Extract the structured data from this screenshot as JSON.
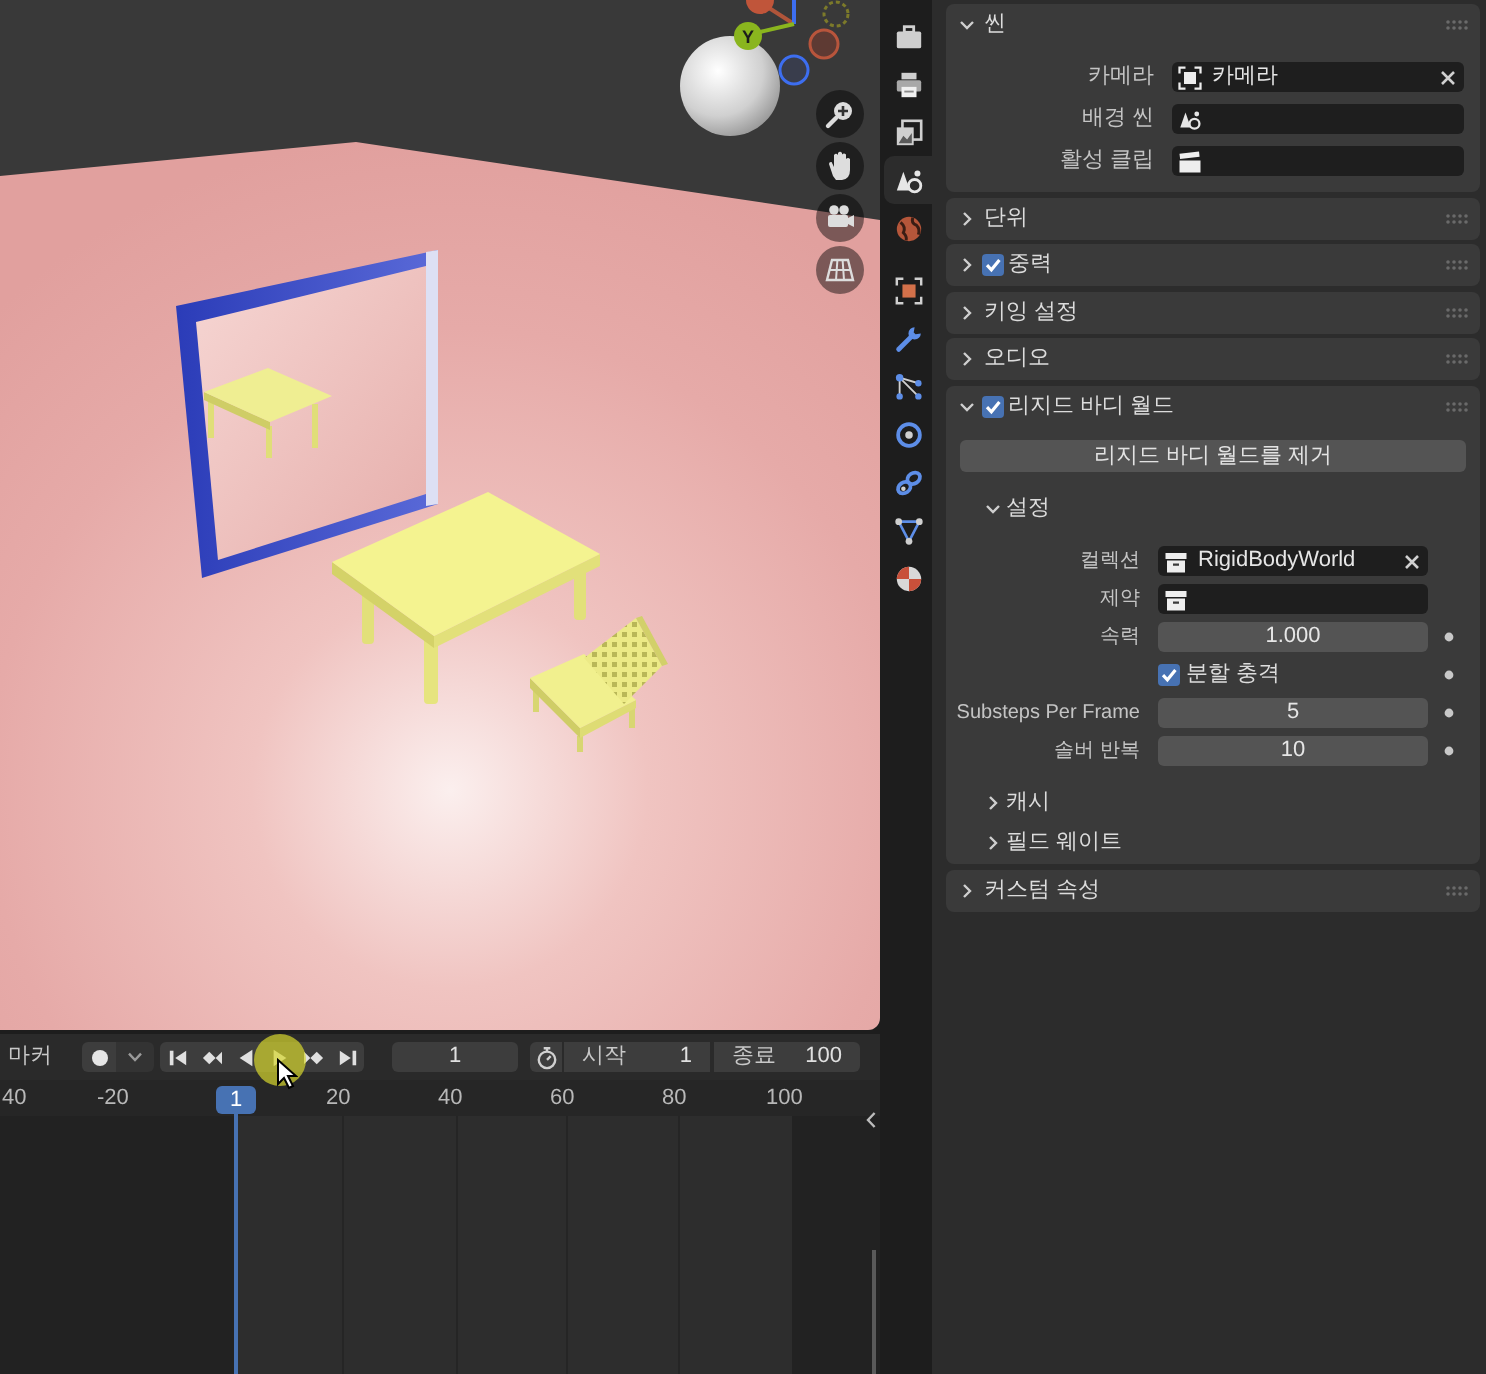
{
  "viewport": {
    "gizmo": {
      "y_label": "Y"
    },
    "nav_buttons": [
      {
        "kind": "zoom"
      },
      {
        "kind": "pan"
      },
      {
        "kind": "camera"
      },
      {
        "kind": "ortho_grid"
      }
    ]
  },
  "timeline": {
    "menu": "마커",
    "recording": false,
    "playback": [
      {
        "kind": "jump_start"
      },
      {
        "kind": "prev_key"
      },
      {
        "kind": "play_reverse"
      },
      {
        "kind": "play"
      },
      {
        "kind": "next_key"
      },
      {
        "kind": "jump_end"
      }
    ],
    "current_frame": "1",
    "start_label": "시작",
    "start": "1",
    "end_label": "종료",
    "end": "100",
    "ruler": [
      "40",
      "-20",
      "20",
      "40",
      "60",
      "80",
      "100"
    ],
    "playhead": "1",
    "pointer": {
      "highlight": true
    }
  },
  "properties": {
    "tab_groups": [
      [
        {
          "kind": "tool",
          "selected": false
        },
        {
          "kind": "render",
          "selected": false
        },
        {
          "kind": "output",
          "selected": false
        },
        {
          "kind": "scene",
          "selected": true
        },
        {
          "kind": "world",
          "selected": false
        }
      ],
      [
        {
          "kind": "object",
          "selected": false
        },
        {
          "kind": "modifiers",
          "selected": false
        },
        {
          "kind": "particles",
          "selected": false
        },
        {
          "kind": "physics",
          "selected": false
        },
        {
          "kind": "constraints",
          "selected": false
        },
        {
          "kind": "data",
          "selected": false
        },
        {
          "kind": "material",
          "selected": false
        }
      ]
    ],
    "panels": [
      {
        "title": "씬",
        "expanded": true,
        "rows": [
          {
            "kind": "camera_field",
            "label": "카메라",
            "value": "카메라",
            "clearable": true
          },
          {
            "kind": "scene_field",
            "label": "배경 씬"
          },
          {
            "kind": "clip_field",
            "label": "활성 클립"
          }
        ]
      },
      {
        "title": "단위",
        "expanded": false
      },
      {
        "title": "중력",
        "checked": true,
        "expanded": false
      },
      {
        "title": "키잉 설정",
        "expanded": false
      },
      {
        "title": "오디오",
        "expanded": false
      },
      {
        "title": "리지드 바디 월드",
        "checked": true,
        "expanded": true,
        "button": "리지드 바디 월드를 제거",
        "subpanels": [
          {
            "title": "설정",
            "expanded": true,
            "rows": [
              {
                "kind": "collection_field",
                "label": "컬렉션",
                "value": "RigidBodyWorld",
                "clearable": true
              },
              {
                "kind": "collection_field",
                "label": "제약"
              },
              {
                "kind": "number",
                "label": "속력",
                "value": "1.000",
                "animatable": true
              },
              {
                "kind": "checkbox",
                "label": "분할 충격",
                "checked": true,
                "animatable": true
              },
              {
                "kind": "number",
                "label": "Substeps Per Frame",
                "value": "5",
                "animatable": true
              },
              {
                "kind": "number",
                "label": "솔버 반복",
                "value": "10",
                "animatable": true
              }
            ]
          },
          {
            "title": "캐시",
            "expanded": false
          },
          {
            "title": "필드 웨이트",
            "expanded": false
          }
        ]
      },
      {
        "title": "커스텀 속성",
        "expanded": false
      }
    ]
  }
}
